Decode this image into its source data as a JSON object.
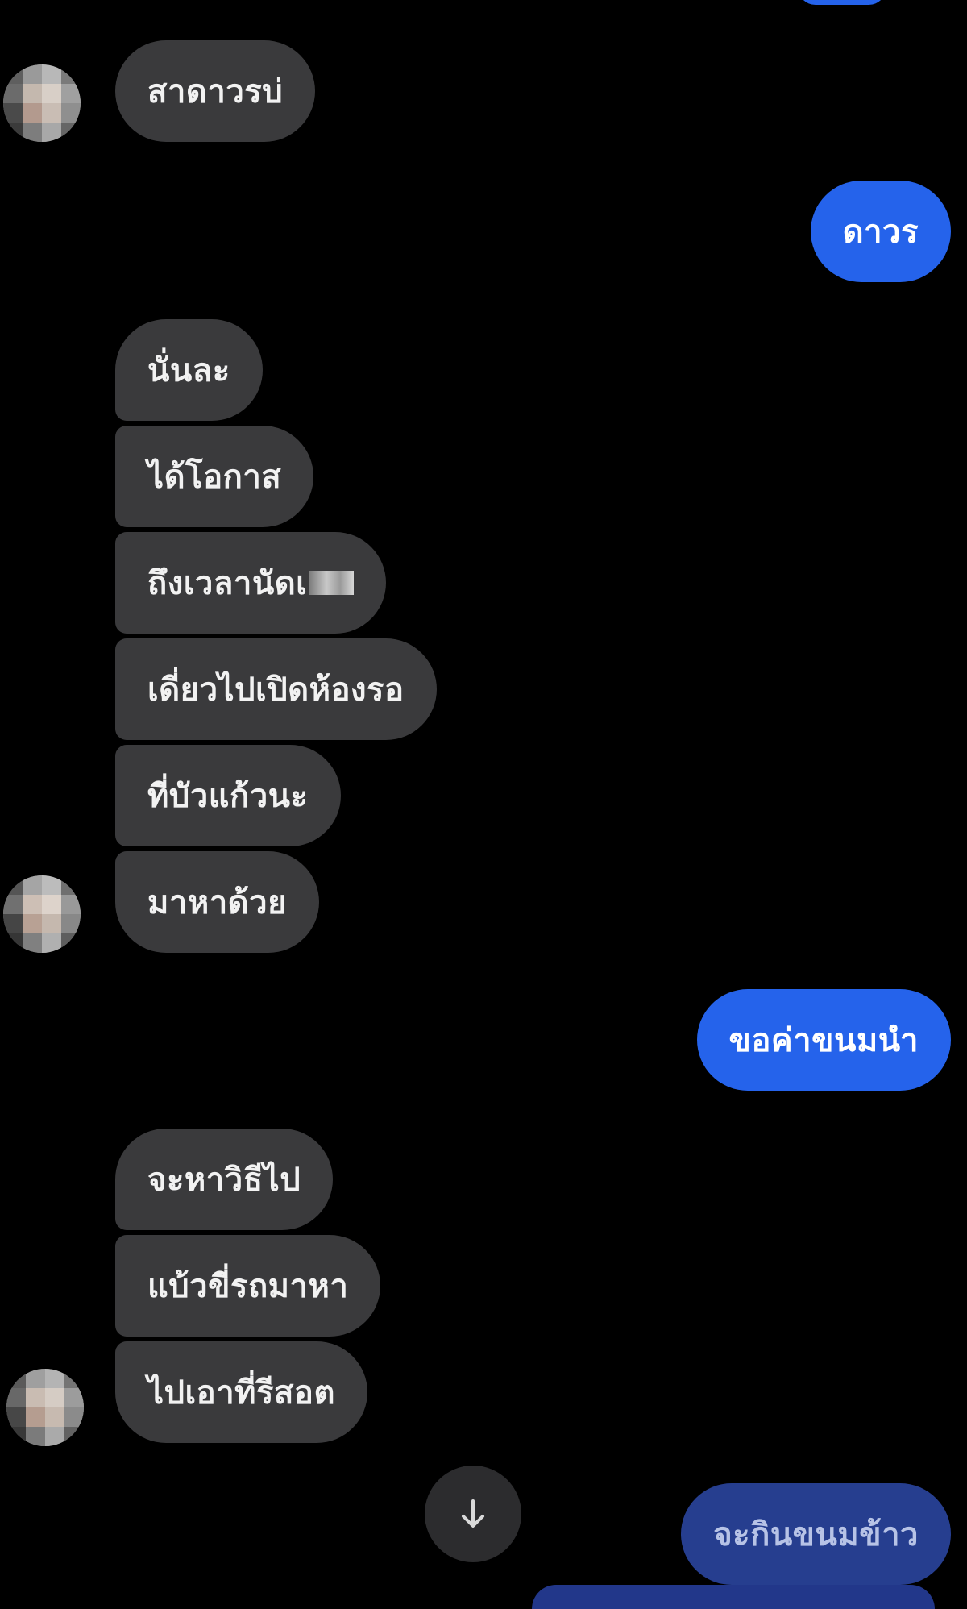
{
  "conversation": {
    "messages": [
      {
        "side": "in",
        "text": "สาดาวรบ่"
      },
      {
        "side": "out",
        "text": "ดาวร"
      },
      {
        "side": "in",
        "text": "นั่นละ"
      },
      {
        "side": "in",
        "text": "ได้โอกาส"
      },
      {
        "side": "in",
        "text": "ถึงเวลานัดเ"
      },
      {
        "side": "in",
        "text": "เดี่ยวไปเปิดห้องรอ"
      },
      {
        "side": "in",
        "text": "ที่บัวแก้วนะ"
      },
      {
        "side": "in",
        "text": "มาหาด้วย"
      },
      {
        "side": "out",
        "text": "ขอค่าขนมนำ"
      },
      {
        "side": "in",
        "text": "จะหาวิธีไป"
      },
      {
        "side": "in",
        "text": "แบ้วขี่รถมาหา"
      },
      {
        "side": "in",
        "text": "ไปเอาที่รีสอต"
      },
      {
        "side": "out",
        "text": "จะกินขนมข้าว"
      }
    ]
  },
  "controls": {
    "scroll_down_icon": "arrow-down-icon"
  },
  "colors": {
    "background": "#000000",
    "incoming_bubble": "#3a3a3c",
    "outgoing_bubble": "#2563eb",
    "text": "#f2f2f2"
  }
}
